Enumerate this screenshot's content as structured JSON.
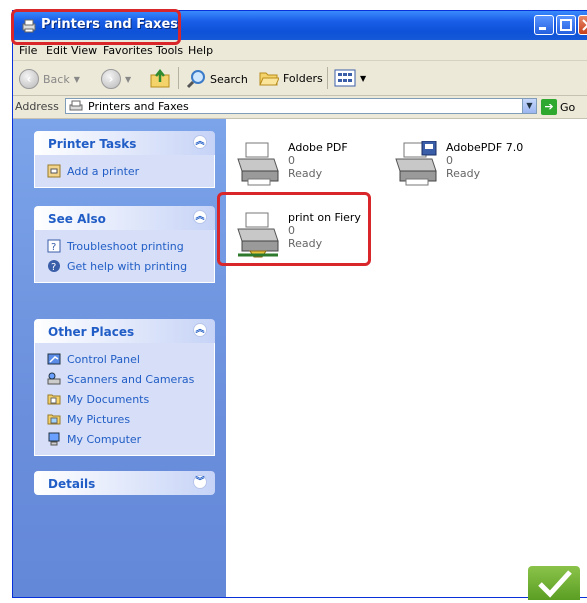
{
  "window": {
    "title": "Printers and Faxes"
  },
  "menu": [
    "File",
    "Edit",
    "View",
    "Favorites",
    "Tools",
    "Help"
  ],
  "toolbar": {
    "back": "Back",
    "search": "Search",
    "folders": "Folders"
  },
  "address": {
    "label": "Address",
    "value": "Printers and Faxes",
    "go": "Go"
  },
  "sidebar": {
    "printer_tasks": {
      "title": "Printer Tasks",
      "items": [
        "Add a printer"
      ]
    },
    "see_also": {
      "title": "See Also",
      "items": [
        "Troubleshoot printing",
        "Get help with printing"
      ]
    },
    "other_places": {
      "title": "Other Places",
      "items": [
        "Control Panel",
        "Scanners and Cameras",
        "My Documents",
        "My Pictures",
        "My Computer"
      ]
    },
    "details": {
      "title": "Details"
    }
  },
  "printers": [
    {
      "name": "Adobe PDF",
      "docs": "0",
      "status": "Ready"
    },
    {
      "name": "AdobePDF 7.0",
      "docs": "0",
      "status": "Ready"
    },
    {
      "name": "print on Fiery",
      "docs": "0",
      "status": "Ready"
    }
  ],
  "colors": {
    "title_bar": "#0d52d8",
    "sidebar": "#6b8fdc",
    "link": "#215dc6",
    "highlight": "#d9262b"
  }
}
